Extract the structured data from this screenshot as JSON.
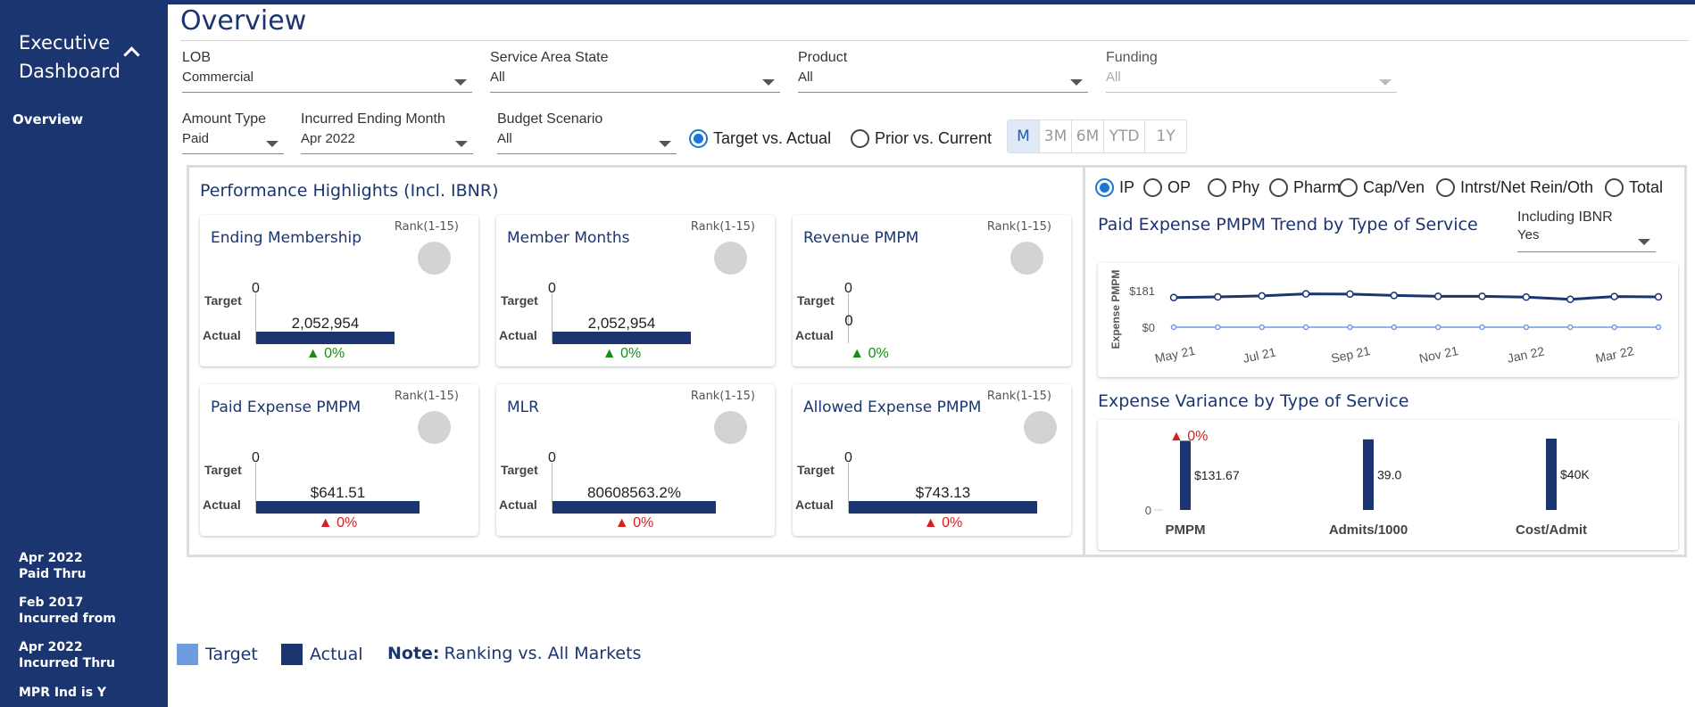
{
  "sidebar": {
    "title_line1": "Executive",
    "title_line2": "Dashboard",
    "nav_overview": "Overview",
    "info": [
      {
        "value": "Apr 2022",
        "label": "Paid Thru"
      },
      {
        "value": "Feb 2017",
        "label": "Incurred from"
      },
      {
        "value": "Apr 2022",
        "label": "Incurred Thru"
      },
      {
        "value": "MPR Ind is Y",
        "label": ""
      }
    ]
  },
  "page": {
    "title": "Overview"
  },
  "filters": {
    "lob": {
      "label": "LOB",
      "value": "Commercial"
    },
    "state": {
      "label": "Service Area State",
      "value": "All"
    },
    "product": {
      "label": "Product",
      "value": "All"
    },
    "funding": {
      "label": "Funding",
      "value": "All"
    },
    "amount_type": {
      "label": "Amount Type",
      "value": "Paid"
    },
    "ending_month": {
      "label": "Incurred Ending Month",
      "value": "Apr 2022"
    },
    "budget": {
      "label": "Budget Scenario",
      "value": "All"
    }
  },
  "compare": {
    "target_vs_actual": "Target vs. Actual",
    "prior_vs_current": "Prior vs. Current",
    "selected": "target_vs_actual"
  },
  "periods": [
    "M",
    "3M",
    "6M",
    "YTD",
    "1Y"
  ],
  "period_selected": "M",
  "highlights": {
    "title": "Performance Highlights (Incl. IBNR)",
    "rank_label": "Rank(1-15)",
    "target_label": "Target",
    "actual_label": "Actual",
    "cards": [
      {
        "title": "Ending Membership",
        "target": "0",
        "actual": "2,052,954",
        "change": "▲ 0%",
        "trend": "up",
        "bar_fraction": 0.67
      },
      {
        "title": "Member Months",
        "target": "0",
        "actual": "2,052,954",
        "change": "▲ 0%",
        "trend": "up",
        "bar_fraction": 0.67
      },
      {
        "title": "Revenue PMPM",
        "target": "0",
        "actual": "0",
        "change": "▲ 0%",
        "trend": "up",
        "bar_fraction": 0
      },
      {
        "title": "Paid Expense PMPM",
        "target": "0",
        "actual": "$641.51",
        "change": "▲ 0%",
        "trend": "down",
        "bar_fraction": 0.79
      },
      {
        "title": "MLR",
        "target": "0",
        "actual": "80608563.2%",
        "change": "▲ 0%",
        "trend": "down",
        "bar_fraction": 0.79
      },
      {
        "title": "Allowed Expense PMPM",
        "target": "0",
        "actual": "$743.13",
        "change": "▲ 0%",
        "trend": "down",
        "bar_fraction": 0.91
      }
    ]
  },
  "service_types": [
    "IP",
    "OP",
    "Phy",
    "Pharm",
    "Cap/Ven",
    "Intrst/Net Rein/Oth",
    "Total"
  ],
  "service_selected": "IP",
  "trend": {
    "title": "Paid Expense PMPM Trend by Type of Service",
    "ibnr_label": "Including IBNR",
    "ibnr_value": "Yes"
  },
  "variance": {
    "title": "Expense Variance by Type of Service"
  },
  "legend": {
    "target": "Target",
    "actual": "Actual",
    "note_bold": "Note:",
    "note_text": "Ranking vs. All Markets"
  },
  "colors": {
    "navy": "#1b3570",
    "target_light": "#6f9be0",
    "accent": "#1976d2",
    "up": "#1a8a1a",
    "down": "#d62020"
  },
  "chart_data": [
    {
      "type": "line",
      "title": "",
      "ylabel": "Expense PMPM",
      "x": [
        "May 21",
        "Jun 21",
        "Jul 21",
        "Aug 21",
        "Sep 21",
        "Oct 21",
        "Nov 21",
        "Dec 21",
        "Jan 22",
        "Feb 22",
        "Mar 22",
        "Apr 22"
      ],
      "x_tick_labels": [
        "May 21",
        "Jul 21",
        "Sep 21",
        "Nov 21",
        "Jan 22",
        "Mar 22"
      ],
      "y_tick_labels": [
        "$181",
        "$0"
      ],
      "ylim": [
        0,
        181
      ],
      "series": [
        {
          "name": "Actual",
          "values": [
            147,
            150,
            155,
            165,
            164,
            157,
            153,
            153,
            149,
            138,
            152,
            150
          ]
        },
        {
          "name": "Target",
          "values": [
            0,
            0,
            0,
            0,
            0,
            0,
            0,
            0,
            0,
            0,
            0,
            0
          ]
        }
      ]
    },
    {
      "type": "bar",
      "title": "",
      "categories": [
        "PMPM",
        "Admits/1000",
        "Cost/Admit"
      ],
      "values": [
        131.67,
        39.0,
        40000
      ],
      "value_labels": [
        "$131.67",
        "39.0",
        "$40K"
      ],
      "top_annotation": "▲ 0%",
      "zero_tick": "0"
    }
  ]
}
